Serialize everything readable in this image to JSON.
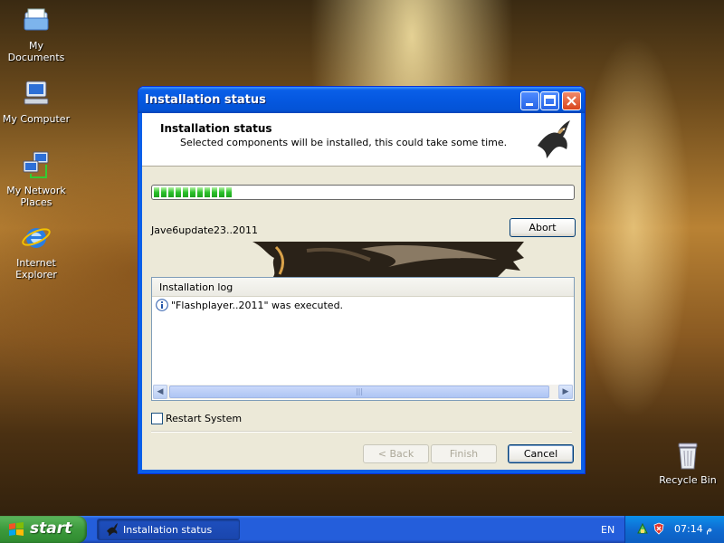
{
  "desktop": {
    "icons": [
      {
        "label": "My Documents",
        "icon": "folder-documents-icon"
      },
      {
        "label": "My Computer",
        "icon": "computer-icon"
      },
      {
        "label": "My Network Places",
        "icon": "network-icon"
      },
      {
        "label": "Internet Explorer",
        "icon": "internet-explorer-icon"
      }
    ],
    "recycle_bin": {
      "label": "Recycle Bin",
      "icon": "recycle-bin-icon"
    }
  },
  "window": {
    "title": "Installation status",
    "header": {
      "title": "Installation status",
      "subtitle": "Selected components will be installed, this could take some time."
    },
    "progress": {
      "fraction": 0.18,
      "blocks": 11
    },
    "current_item": "Jave6update23..2011",
    "abort_label": "Abort",
    "log": {
      "header": "Installation log",
      "entries": [
        {
          "icon": "info-icon",
          "text": "\"Flashplayer..2011\" was executed."
        }
      ]
    },
    "restart_label": "Restart System",
    "buttons": {
      "back": "< Back",
      "finish": "Finish",
      "cancel": "Cancel"
    }
  },
  "taskbar": {
    "start_label": "start",
    "task_label": "Installation status",
    "language": "EN",
    "clock": "07:14 م"
  },
  "colors": {
    "titlebar": "#0558e0",
    "taskbar": "#245edb",
    "start": "#3c9a3c",
    "progress": "#2bc12b"
  }
}
